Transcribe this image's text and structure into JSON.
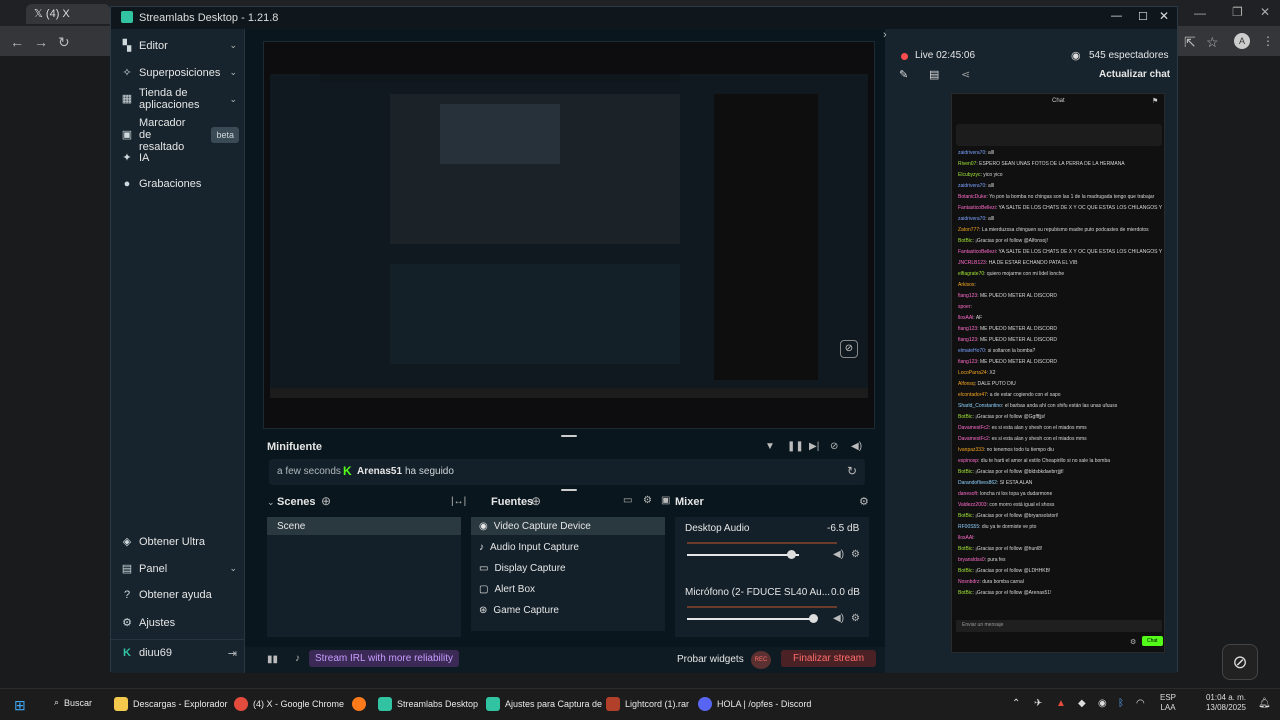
{
  "chrome": {
    "tab_title": "(4) X",
    "window_controls": [
      "minimize",
      "maximize",
      "close"
    ]
  },
  "window": {
    "title": "Streamlabs Desktop - 1.21.8"
  },
  "sidebar": {
    "items": [
      {
        "label": "Editor",
        "icon": "editor-icon"
      },
      {
        "label": "Superposiciones",
        "icon": "overlays-icon"
      },
      {
        "label": "Tienda de aplicaciones",
        "icon": "app-store-icon"
      },
      {
        "label": "Marcador de resaltado",
        "icon": "highlighter-icon",
        "badge": "beta"
      },
      {
        "label": "IA",
        "icon": "ai-icon"
      },
      {
        "label": "Grabaciones",
        "icon": "recordings-icon"
      }
    ],
    "bottom": [
      {
        "label": "Obtener Ultra",
        "icon": "ultra-icon"
      },
      {
        "label": "Panel",
        "icon": "panel-icon"
      },
      {
        "label": "Obtener ayuda",
        "icon": "help-icon"
      },
      {
        "label": "Ajustes",
        "icon": "settings-icon"
      }
    ],
    "user": "diuu69"
  },
  "minifeed": {
    "title": "Minifuente",
    "event_time": "a few seconds",
    "event_user": "Arenas51",
    "event_action": "ha seguido"
  },
  "scenes": {
    "title": "Scenes",
    "items": [
      "Scene"
    ]
  },
  "sources": {
    "title": "Fuentes",
    "items": [
      "Video Capture Device",
      "Audio Input Capture",
      "Display Capture",
      "Alert Box",
      "Game Capture"
    ]
  },
  "mixer": {
    "title": "Mixer",
    "channels": [
      {
        "name": "Desktop Audio",
        "level": "-6.5 dB",
        "volume": 0.78
      },
      {
        "name": "Micrófono (2- FDUCE SL40 Au...",
        "level": "0.0 dB",
        "volume": 0.97
      }
    ]
  },
  "bottom_bar": {
    "promo": "Stream IRL with more reliability",
    "test_widgets": "Probar widgets",
    "rec": "REC",
    "end_stream": "Finalizar stream"
  },
  "live": {
    "status": "Live 02:45:06",
    "viewers": "545 espectadores",
    "refresh_chat": "Actualizar chat"
  },
  "chat": {
    "header": "Chat",
    "input_placeholder": "Enviar un mensaje",
    "send": "Chat",
    "lines": [
      {
        "user": "zaidrivera70",
        "text": "alll",
        "cls": "u3"
      },
      {
        "user": "Riven07",
        "text": "ESPERO SEAN UNAS FOTOS DE LA PERRA DE LA HERMANA",
        "cls": "u1"
      },
      {
        "user": "Elcubyzyc",
        "text": "yico yico",
        "cls": "u1"
      },
      {
        "user": "zaidrivera70",
        "text": "alll",
        "cls": "u3"
      },
      {
        "user": "BotanicDuke",
        "text": "Yo pon la bomba no chingas son las 1 de la madrugada tengo que trabajar",
        "cls": "u2"
      },
      {
        "user": "FantasticoBellezi",
        "text": "YA SALTE DE LOS CHATS DE X Y OC QUE ESTAS LOS CHILANGOS Y VAS A FILTRAR UNA MAMADA JAJA",
        "cls": "u2"
      },
      {
        "user": "zaidrivera70",
        "text": "alll",
        "cls": "u3"
      },
      {
        "user": "Zaton777",
        "text": "La mierduzssa chinguen su repubismo madre puto podcastes de mierdotos",
        "cls": "u4"
      },
      {
        "user": "BotBic",
        "text": "¡Gracias por el follow @Alfonsoj!",
        "cls": "u1"
      },
      {
        "user": "FantasticoBellezi",
        "text": "YA SALTE DE LOS CHATS DE X Y OC QUE ESTAS LOS CHILANGOS Y VAS A FILTRAR UNA MAMADA JAJA",
        "cls": "u2"
      },
      {
        "user": "JNCRLB123",
        "text": "HA DE ESTAR ECHANDO PATA EL VIB",
        "cls": "u2"
      },
      {
        "user": "elfiagrate70",
        "text": "quiero mojarme con mi lidel lonche",
        "cls": "u1"
      },
      {
        "user": "Arkisos",
        "text": "",
        "cls": "u4"
      },
      {
        "user": "fiang123",
        "text": "ME PUEDO METER AL DISCORD",
        "cls": "u2"
      },
      {
        "user": "spoer",
        "text": "",
        "cls": "u2"
      },
      {
        "user": "llosAAl",
        "text": "AF",
        "cls": "u2"
      },
      {
        "user": "fiang123",
        "text": "ME PUEDO METER AL DISCORD",
        "cls": "u2"
      },
      {
        "user": "fiang123",
        "text": "ME PUEDO METER AL DISCORD",
        "cls": "u2"
      },
      {
        "user": "elmateHo70",
        "text": "si soltaron la bomba?",
        "cls": "u3"
      },
      {
        "user": "fiang123",
        "text": "ME PUEDO METER AL DISCORD",
        "cls": "u2"
      },
      {
        "user": "LocoParra24",
        "text": "X2",
        "cls": "u4"
      },
      {
        "user": "Alfonsq",
        "text": "DALE PUTO DIU",
        "cls": "u4"
      },
      {
        "user": "elcontador47",
        "text": "a de estar cogiendo con el sapo",
        "cls": "u4"
      },
      {
        "user": "Sharld_Constantino",
        "text": "el barbas anda ahí con shifu están las unas ufuuss",
        "cls": "u5"
      },
      {
        "user": "BotBic",
        "text": "¡Gracias por el follow @Ggfffjjs!",
        "cls": "u1"
      },
      {
        "user": "DavamestFc2",
        "text": "es si esta alan y shesh con el miados mms",
        "cls": "u2"
      },
      {
        "user": "DavamestFc2",
        "text": "es si esta alan y shesh con el miados mms",
        "cls": "u2"
      },
      {
        "user": "Ivanpaz333",
        "text": "no tenemos todo tu tiempo diu",
        "cls": "u4"
      },
      {
        "user": "espinosp",
        "text": "diu te harti el amor al estilo Cheapirillo si no sale la bomba",
        "cls": "u2"
      },
      {
        "user": "BotBic",
        "text": "¡Gracias por el follow @bldsbkdaebrrjjjt!",
        "cls": "u1"
      },
      {
        "user": "Darandoflives862",
        "text": "SI ESTA ALAN",
        "cls": "u5"
      },
      {
        "user": "danesoft",
        "text": "loncha ni los topa ya dudarmone",
        "cls": "u2"
      },
      {
        "user": "Valdezz2003",
        "text": "con morro está igual el shoss",
        "cls": "u2"
      },
      {
        "user": "BotBic",
        "text": "¡Gracias por el follow @bryansolstori!",
        "cls": "u1"
      },
      {
        "user": "RF00S55",
        "text": "diu ya te dormiste ve pto",
        "cls": "u5"
      },
      {
        "user": "llosAAl",
        "text": "",
        "cls": "u2"
      },
      {
        "user": "BotBic",
        "text": "¡Gracias por el follow @hunl8!",
        "cls": "u1"
      },
      {
        "user": "bryansldss0",
        "text": "pura fes",
        "cls": "u2"
      },
      {
        "user": "BotBic",
        "text": "¡Gracias por el follow @LDHHKB!",
        "cls": "u1"
      },
      {
        "user": "Nosnbdrz",
        "text": "dura bomba carnal",
        "cls": "u2"
      },
      {
        "user": "BotBic",
        "text": "¡Gracias por el follow @Arenas51!",
        "cls": "u1"
      }
    ]
  },
  "taskbar": {
    "search": "Buscar",
    "apps": [
      {
        "label": "Descargas - Explorador",
        "color": "#f2c94c"
      },
      {
        "label": "(4) X - Google Chrome",
        "color": "#e34c3c"
      },
      {
        "label": "",
        "color": "#ff7a1a"
      },
      {
        "label": "Streamlabs Desktop",
        "color": "#31c3a2"
      },
      {
        "label": "Ajustes para Captura de",
        "color": "#31c3a2"
      },
      {
        "label": "Lightcord (1).rar",
        "color": "#b0402a"
      },
      {
        "label": "HOLA | /opfes - Discord",
        "color": "#5865f2"
      }
    ],
    "lang": "ESP",
    "lang2": "LAA",
    "time": "01:04 a. m.",
    "date": "13/08/2025"
  }
}
